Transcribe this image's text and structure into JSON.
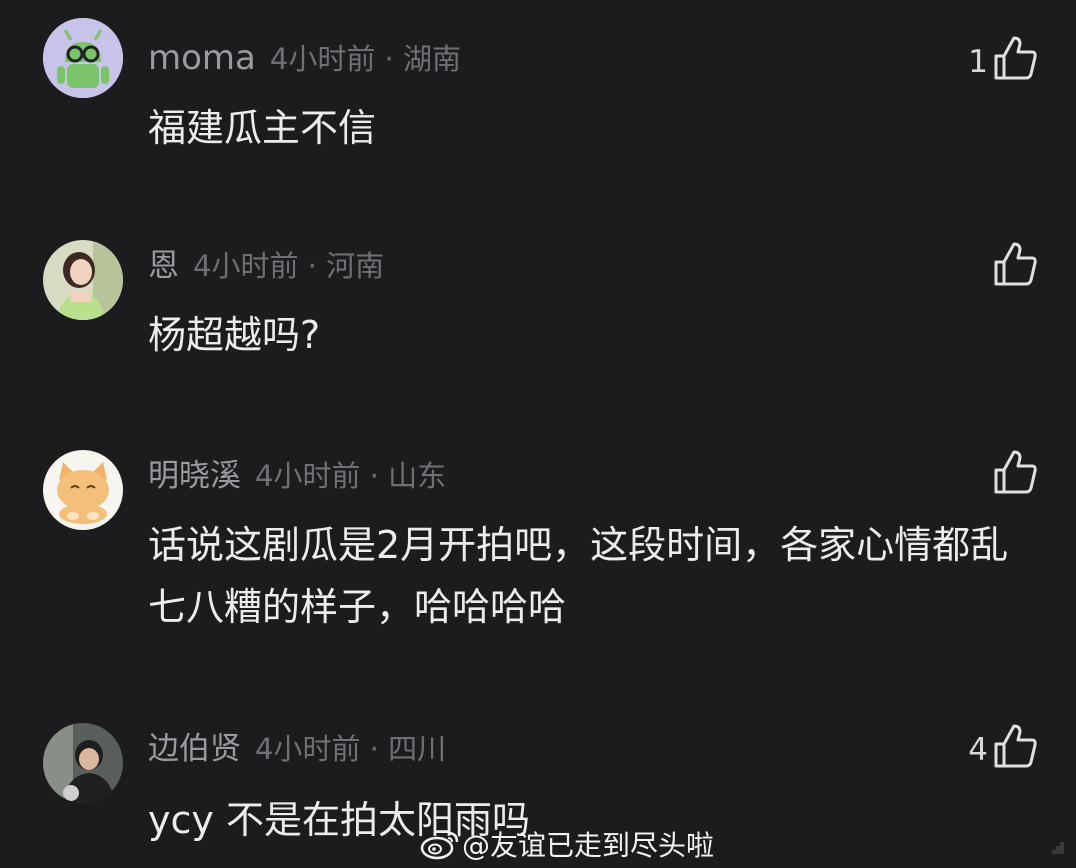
{
  "comments": [
    {
      "user": "moma",
      "meta": "4小时前 · 湖南",
      "text": "福建瓜主不信",
      "likes": "1",
      "avatar_icon": "android-robot-glasses-avatar"
    },
    {
      "user": "恩",
      "meta": "4小时前 · 河南",
      "text": "杨超越吗?",
      "likes": "",
      "avatar_icon": "photo-girl-avatar"
    },
    {
      "user": "明晓溪",
      "meta": "4小时前 · 山东",
      "text": "话说这剧瓜是2月开拍吧，这段时间，各家心情都乱七八糟的样子，哈哈哈哈",
      "likes": "",
      "avatar_icon": "cat-avatar"
    },
    {
      "user": "边伯贤",
      "meta": "4小时前 · 四川",
      "text": "ycy 不是在拍太阳雨吗",
      "likes": "4",
      "avatar_icon": "photo-man-avatar"
    }
  ],
  "watermark": {
    "text": "@友谊已走到尽头啦",
    "icon": "weibo-logo-icon"
  },
  "colors": {
    "background": "#1c1c1e",
    "username": "#9a9aa0",
    "comment_text": "#ececec"
  }
}
